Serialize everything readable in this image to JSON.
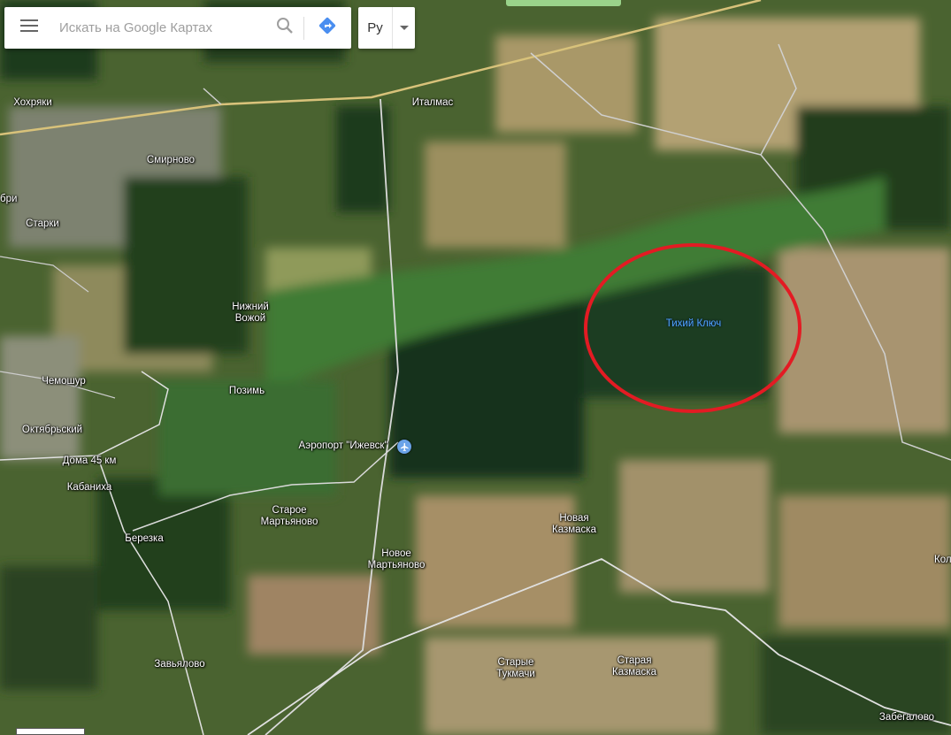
{
  "search": {
    "placeholder": "Искать на Google Картах"
  },
  "language": {
    "selected": "Ру"
  },
  "icons": {
    "menu": "hamburger-icon",
    "search": "search-icon",
    "directions": "directions-icon",
    "dropdown": "caret-down-icon",
    "airport": "airplane-icon"
  },
  "colors": {
    "highlight_circle": "#e31b23",
    "directions": "#4a8ef0",
    "water_label": "#4fa3ff"
  },
  "places": {
    "hohryaki": "Хохряки",
    "smirnovo": "Смирново",
    "italmas": "Италмас",
    "bri": "бри",
    "starki": "Старки",
    "nizhny_vozhoy": "Нижний\nВожой",
    "tikhy_klyuch": "Тихий Ключ",
    "chemoshur": "Чемошур",
    "pozim": "Позимь",
    "oktyabrsky": "Октябрьский",
    "doma45": "Дома 45 км",
    "airport": "Аэропорт \"Ижевск\"",
    "kabanikha": "Кабаниха",
    "staroe_martyanovo": "Старое\nМартьяново",
    "berezka": "Березка",
    "novaya_kazmaska": "Новая\nКазмаска",
    "novoe_martyanovo": "Новое\nМартьяново",
    "kol": "Кол",
    "zavyalovo": "Завьялово",
    "starye_tukmachi": "Старые\nТукмачи",
    "staraya_kazmaska": "Старая\nКазмаска",
    "zabegalovo": "Забегалово"
  }
}
